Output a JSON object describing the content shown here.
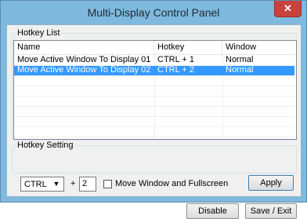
{
  "window": {
    "title": "Multi-Display Control Panel",
    "close_glyph": "✕"
  },
  "hotkey_list": {
    "legend": "Hotkey List",
    "columns": [
      "Name",
      "Hotkey",
      "Window"
    ],
    "rows": [
      {
        "name": "Move Active Window To Display 01",
        "hotkey": "CTRL + 1",
        "window": "Normal",
        "selected": false
      },
      {
        "name": "Move Active Window To Display 02",
        "hotkey": "CTRL + 2",
        "window": "Normal",
        "selected": true
      }
    ]
  },
  "hotkey_setting": {
    "legend": "Hotkey Setting",
    "modifier_value": "CTRL",
    "dropdown_glyph": "▼",
    "plus": "+",
    "key_value": "2",
    "fullscreen_label": "Move Window and Fullscreen",
    "fullscreen_checked": false,
    "apply_label": "Apply"
  },
  "footer": {
    "disable_label": "Disable",
    "exit_label": "Save / Exit"
  },
  "colors": {
    "title_bar": "#7fb9dd",
    "close": "#c8433b",
    "selection": "#3399ff",
    "client": "#f0f0f0"
  }
}
